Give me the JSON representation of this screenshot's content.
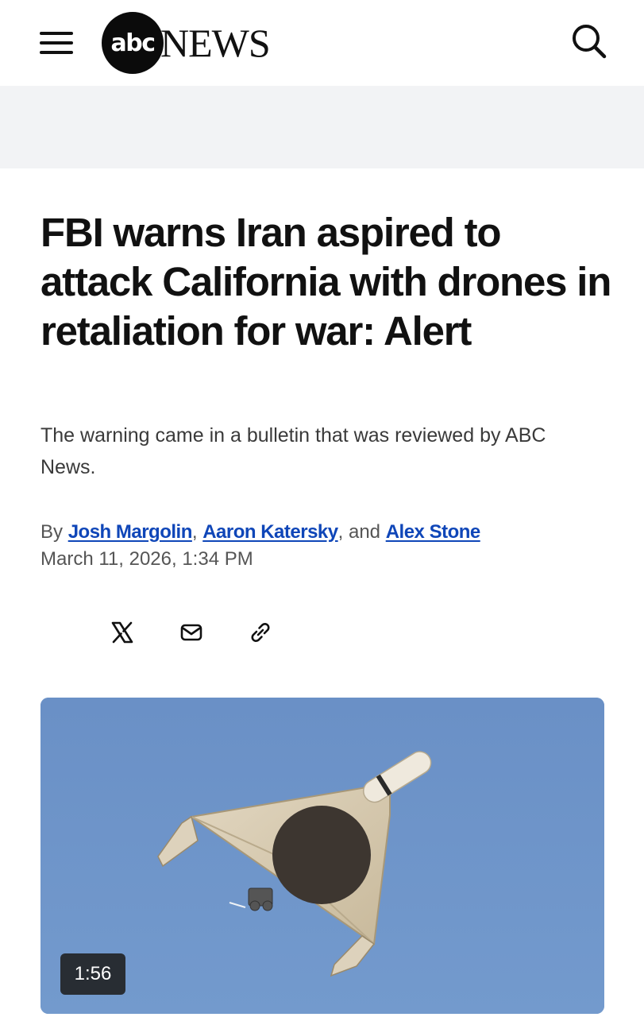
{
  "header": {
    "menu_icon": "hamburger-menu-icon",
    "logo_mark": "abc",
    "logo_text": "NEWS",
    "search_icon": "search-icon"
  },
  "article": {
    "headline": "FBI warns Iran aspired to attack California with drones in retaliation for war: Alert",
    "subheadline": "The warning came in a bulletin that was reviewed by ABC News.",
    "byline": {
      "prefix": "By",
      "authors": [
        "Josh Margolin",
        "Aaron Katersky",
        "Alex Stone"
      ],
      "sep1": ",",
      "sep2": ", and"
    },
    "date": "March 11, 2026, 1:34 PM"
  },
  "share": {
    "icons": [
      "x-icon",
      "mail-icon",
      "link-icon"
    ]
  },
  "media": {
    "duration": "1:56",
    "colors": {
      "sky": "#6f95c9",
      "drone": "#d8ccb4"
    }
  },
  "colors": {
    "link": "#0f46b8",
    "header_band": "#f2f3f5"
  }
}
